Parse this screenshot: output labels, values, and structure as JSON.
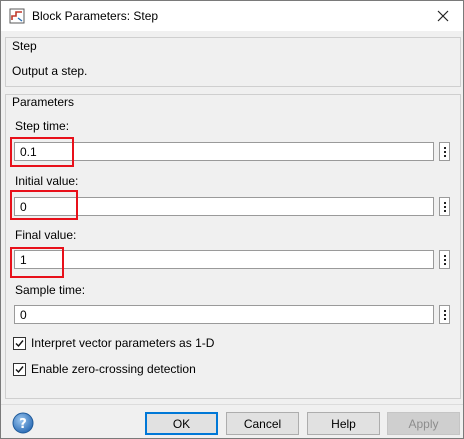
{
  "window": {
    "title": "Block Parameters: Step"
  },
  "step_group": {
    "label": "Step",
    "description": "Output a step."
  },
  "parameters_group": {
    "label": "Parameters",
    "fields": [
      {
        "label": "Step time:",
        "value": "0.1",
        "highlighted": true
      },
      {
        "label": "Initial value:",
        "value": "0",
        "highlighted": true
      },
      {
        "label": "Final value:",
        "value": "1",
        "highlighted": true
      },
      {
        "label": "Sample time:",
        "value": "0",
        "highlighted": false
      }
    ],
    "checkboxes": [
      {
        "label": "Interpret vector parameters as 1-D",
        "checked": true
      },
      {
        "label": "Enable zero-crossing detection",
        "checked": true
      }
    ]
  },
  "buttons": {
    "ok": "OK",
    "cancel": "Cancel",
    "help": "Help",
    "apply": "Apply"
  },
  "colors": {
    "highlight": "#e8101a",
    "default_button_border": "#0078d7"
  },
  "icons": {
    "app": "simulink-block-icon",
    "close": "close-icon",
    "help": "help-question-icon",
    "more": "vertical-ellipsis-icon",
    "check": "checkmark-icon"
  }
}
